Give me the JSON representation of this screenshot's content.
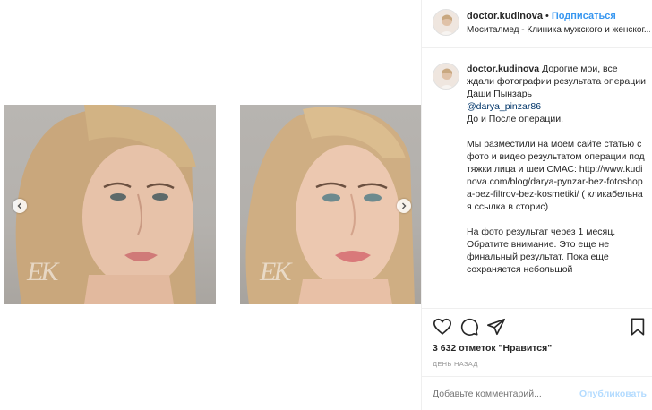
{
  "post": {
    "username": "doctor.kudinova",
    "follow_label": "Подписаться",
    "separator": "•",
    "location": "Моситалмед - Клиника мужского и женског..."
  },
  "caption": {
    "username": "doctor.kudinova",
    "paragraphs": [
      "Дорогие мои, все ждали фотографии результата операции Даши Пынзарь",
      "@darya_pinzar86",
      "До и После операции.",
      "Мы разместили на моем сайте статью с фото и видео результатом операции подтяжки лица и шеи СМАС: http://www.kudinova.com/blog/darya-pynzar-bez-fotoshopa-bez-filtrov-bez-kosmetiki/ ( кликабельная ссылка в сторис)",
      "На фото результат через 1 месяц. Обратите внимание. Это еще не финальный результат. Пока еще сохраняется небольшой"
    ]
  },
  "engagement": {
    "likes_label": "3 632 отметок \"Нравится\"",
    "time_label": "день назад"
  },
  "comment": {
    "placeholder": "Добавьте комментарий...",
    "publish_label": "Опубликовать"
  },
  "media": {
    "watermark": "ЕК"
  },
  "colors": {
    "accent": "#3897f0",
    "mention": "#003569",
    "muted": "#999999",
    "publish_disabled": "#b3dbff"
  },
  "icons": {
    "like": "heart-icon",
    "comment": "comment-icon",
    "share": "share-icon",
    "save": "bookmark-icon",
    "prev": "chevron-left-icon",
    "next": "chevron-right-icon"
  }
}
